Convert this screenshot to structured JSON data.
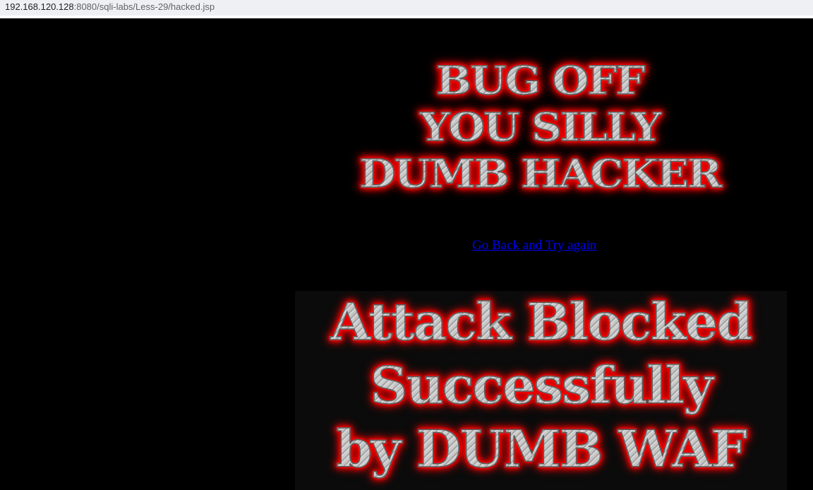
{
  "browser": {
    "url_host": "192.168.120.128",
    "url_rest": ":8080/sqli-labs/Less-29/hacked.jsp"
  },
  "page": {
    "hacker_banner": {
      "lines": [
        "BUG OFF",
        "YOU SILLY",
        "DUMB HACKER"
      ]
    },
    "go_back_link": "Go Back and Try again",
    "waf_banner": {
      "lines": [
        "Attack Blocked",
        "Successfully",
        "by DUMB WAF"
      ]
    },
    "colors": {
      "background": "#000000",
      "glow": "#ff0000",
      "link": "#0000ee",
      "address_bar": "#eef0f4"
    }
  }
}
